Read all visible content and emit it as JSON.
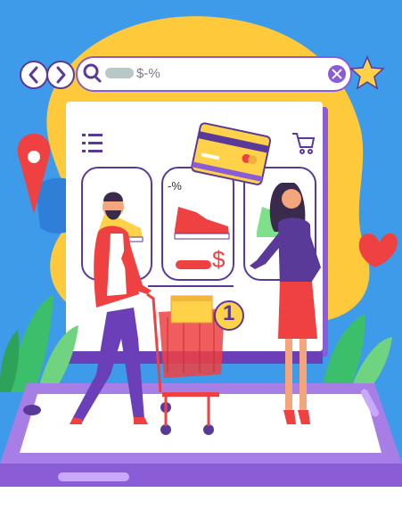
{
  "search": {
    "query": "$-%"
  },
  "product": {
    "discount_label": "-%",
    "price_symbol": "$"
  },
  "cart": {
    "item_count": "1"
  },
  "icons": {
    "back": "chevron-left-icon",
    "forward": "chevron-right-icon",
    "search": "search-icon",
    "clear": "close-icon",
    "favorite": "star-icon",
    "menu": "menu-icon",
    "cart": "cart-icon",
    "location": "location-pin-icon",
    "like": "heart-icon"
  },
  "colors": {
    "background": "#3d9be9",
    "blob": "#ffc93c",
    "accent_purple": "#8a5cd6",
    "sale_red": "#ef4142",
    "card_yellow": "#ffd24a"
  }
}
